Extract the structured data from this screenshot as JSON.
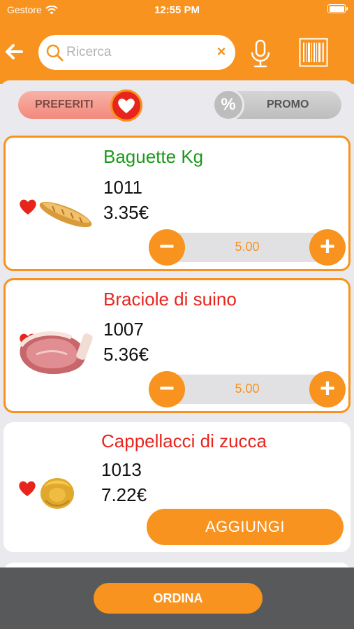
{
  "status_bar": {
    "carrier": "Gestore",
    "time": "12:55 PM"
  },
  "header": {
    "back_icon": "arrow-left-icon",
    "search": {
      "placeholder": "Ricerca",
      "value": "",
      "clear_label": "×"
    },
    "mic_icon": "microphone-icon",
    "barcode_icon": "barcode-icon"
  },
  "filters": {
    "favorites_label": "PREFERITI",
    "favorites_on": true,
    "promo_label": "PROMO",
    "promo_symbol": "%",
    "promo_on": false
  },
  "products": [
    {
      "name": "Baguette Kg",
      "name_color": "#1a9a1a",
      "code": "1011",
      "price": "3.35€",
      "quantity": "5.00",
      "favorite": true,
      "in_cart": true
    },
    {
      "name": "Braciole di suino",
      "name_color": "#e8251d",
      "code": "1007",
      "price": "5.36€",
      "quantity": "5.00",
      "favorite": true,
      "in_cart": true
    },
    {
      "name": "Cappellacci di zucca",
      "name_color": "#e8251d",
      "code": "1013",
      "price": "7.22€",
      "add_label": "AGGIUNGI",
      "favorite": true,
      "in_cart": false
    }
  ],
  "stepper": {
    "minus": "−",
    "plus": "+"
  },
  "footer": {
    "order_label": "ORDINA"
  },
  "colors": {
    "accent": "#f7931e",
    "heart": "#e8251d",
    "footer": "#58595b"
  }
}
